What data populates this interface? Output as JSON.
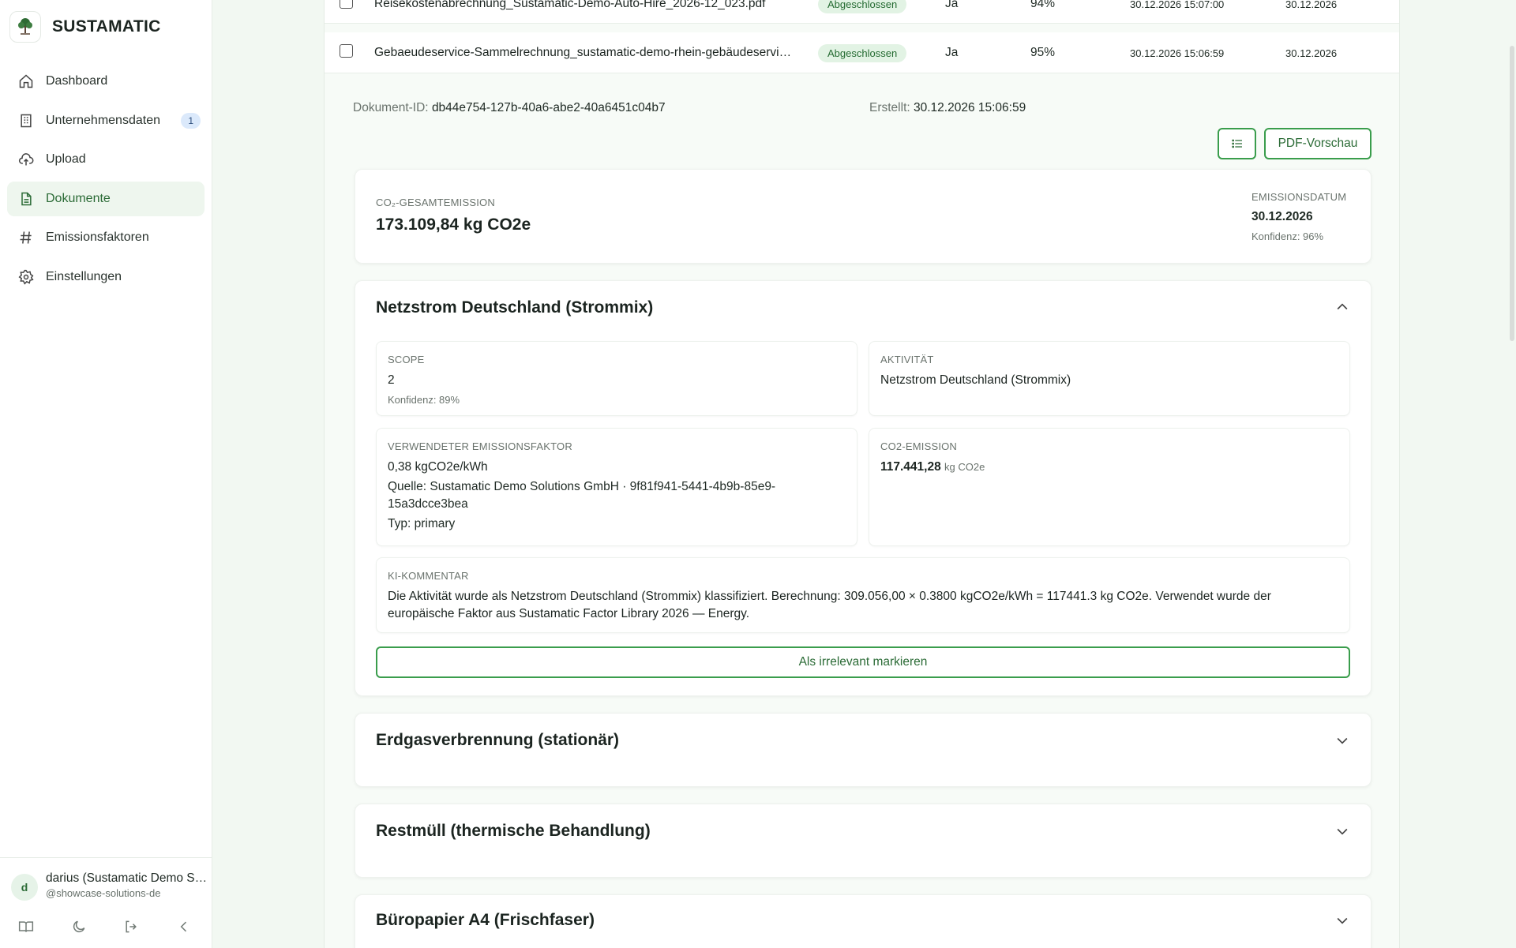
{
  "app": {
    "name": "SUSTAMATIC"
  },
  "sidebar": {
    "items": [
      {
        "label": "Dashboard",
        "icon": "home-icon"
      },
      {
        "label": "Unternehmensdaten",
        "icon": "building-icon",
        "badge": "1"
      },
      {
        "label": "Upload",
        "icon": "cloud-upload-icon"
      },
      {
        "label": "Dokumente",
        "icon": "document-icon",
        "active": true
      },
      {
        "label": "Emissionsfaktoren",
        "icon": "hash-icon"
      },
      {
        "label": "Einstellungen",
        "icon": "gear-icon"
      }
    ],
    "user": {
      "initial": "d",
      "name": "darius (Sustamatic Demo Solutions)",
      "handle": "@showcase-solutions-de"
    }
  },
  "table": {
    "rows": [
      {
        "file": "Reisekostenabrechnung_Sustamatic-Demo-Auto-Hire_2026-12_023.pdf",
        "status": "Abgeschlossen",
        "flag": "Ja",
        "confidence": "94%",
        "timestamp": "30.12.2026 15:07:00",
        "date": "30.12.2026"
      },
      {
        "file": "Gebaeudeservice-Sammelrechnung_sustamatic-demo-rhein-gebäudeservice.pdf",
        "status": "Abgeschlossen",
        "flag": "Ja",
        "confidence": "95%",
        "timestamp": "30.12.2026 15:06:59",
        "date": "30.12.2026"
      }
    ]
  },
  "detail": {
    "doc_id_label": "Dokument-ID:",
    "doc_id": "db44e754-127b-40a6-abe2-40a6451c04b7",
    "created_label": "Erstellt:",
    "created": "30.12.2026 15:06:59",
    "pdf_button": "PDF-Vorschau",
    "summary": {
      "total_label": "CO₂-GESAMTEMISSION",
      "total_value": "173.109,84 kg CO2e",
      "date_label": "EMISSIONSDATUM",
      "date_value": "30.12.2026",
      "confidence": "Konfidenz: 96%"
    },
    "activity": {
      "title": "Netzstrom Deutschland (Strommix)",
      "scope_label": "SCOPE",
      "scope_value": "2",
      "scope_conf": "Konfidenz: 89%",
      "activity_label": "AKTIVITÄT",
      "activity_value": "Netzstrom Deutschland (Strommix)",
      "factor_label": "VERWENDETER EMISSIONSFAKTOR",
      "factor_value": "0,38 kgCO2e/kWh",
      "factor_source": "Quelle: Sustamatic Demo Solutions GmbH · 9f81f941-5441-4b9b-85e9-15a3dcce3bea",
      "factor_type": "Typ: primary",
      "emission_label": "CO2-EMISSION",
      "emission_value": "117.441,28",
      "emission_unit": "kg CO2e",
      "comment_label": "KI-KOMMENTAR",
      "comment": "Die Aktivität wurde als Netzstrom Deutschland (Strommix) klassifiziert. Berechnung: 309.056,00 × 0.3800 kgCO2e/kWh = 117441.3 kg CO2e. Verwendet wurde der europäische Faktor aus Sustamatic Factor Library 2026 — Energy.",
      "mark_button": "Als irrelevant markieren"
    },
    "collapsed": [
      {
        "title": "Erdgasverbrennung (stationär)"
      },
      {
        "title": "Restmüll (thermische Behandlung)"
      },
      {
        "title": "Büropapier A4 (Frischfaser)"
      }
    ]
  }
}
